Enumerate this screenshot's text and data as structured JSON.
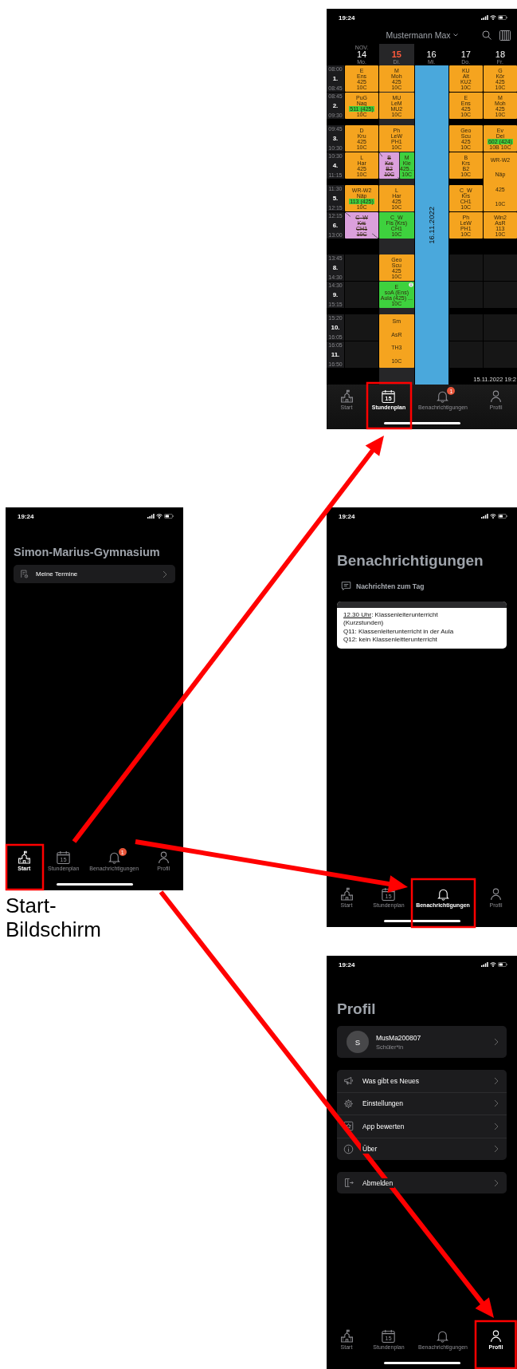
{
  "screens": [
    {
      "kind": "timetable",
      "status_time": "19:24",
      "person": "Mustermann Max",
      "timestamp": "15.11.2022 19:2",
      "periods": [
        {
          "kind": "period",
          "number": "1.",
          "start": "08:00",
          "end": "08:45"
        },
        {
          "kind": "period",
          "number": "2.",
          "start": "08:45",
          "end": "09:30"
        },
        {
          "kind": "break"
        },
        {
          "kind": "period",
          "number": "3.",
          "start": "09:45",
          "end": "10:30"
        },
        {
          "kind": "period",
          "number": "4.",
          "start": "10:30",
          "end": "11:15"
        },
        {
          "kind": "break"
        },
        {
          "kind": "period",
          "number": "5.",
          "start": "11:30",
          "end": "12:15"
        },
        {
          "kind": "period",
          "number": "6.",
          "start": "12:15",
          "end": "13:00"
        },
        {
          "kind": "free"
        },
        {
          "kind": "period",
          "number": "8.",
          "start": "13:45",
          "end": "14:30"
        },
        {
          "kind": "period",
          "number": "9.",
          "start": "14:30",
          "end": "15:15"
        },
        {
          "kind": "break"
        },
        {
          "kind": "period",
          "number": "10.",
          "start": "15:20",
          "end": "16:05"
        },
        {
          "kind": "period",
          "number": "11.",
          "start": "16:05",
          "end": "16:50"
        }
      ],
      "days": [
        {
          "month": "NOV.",
          "date": "14",
          "weekday": "Mo.",
          "today": false,
          "cells": [
            {
              "kind": "lesson",
              "changed": false,
              "cancelled": false,
              "lines": [
                "E",
                "Ens",
                "425",
                "10C"
              ]
            },
            {
              "kind": "lesson",
              "changed": false,
              "cancelled": false,
              "room_changed": true,
              "lines": [
                "PuG",
                "Nag",
                "511 (425)",
                "10C"
              ]
            },
            {
              "kind": "empty"
            },
            {
              "kind": "lesson",
              "changed": false,
              "cancelled": false,
              "lines": [
                "D",
                "Kru",
                "425",
                "10C"
              ]
            },
            {
              "kind": "lesson",
              "changed": false,
              "cancelled": false,
              "lines": [
                "L",
                "Har",
                "425",
                "10C"
              ]
            },
            {
              "kind": "empty"
            },
            {
              "kind": "lesson",
              "changed": false,
              "cancelled": false,
              "room_changed": true,
              "lines": [
                "WR-W2",
                "Näp",
                "113 (425)",
                "10C"
              ]
            },
            {
              "kind": "lesson",
              "changed": false,
              "cancelled": true,
              "lines": [
                "C_W",
                "Krs",
                "CH1",
                "10C"
              ]
            },
            {
              "kind": "empty"
            },
            {
              "kind": "empty"
            },
            {
              "kind": "empty"
            },
            {
              "kind": "empty"
            },
            {
              "kind": "empty"
            },
            {
              "kind": "empty"
            }
          ]
        },
        {
          "date": "15",
          "weekday": "Di.",
          "today": true,
          "cells": [
            {
              "kind": "lesson",
              "changed": false,
              "cancelled": false,
              "lines": [
                "M",
                "Moh",
                "425",
                "10C"
              ]
            },
            {
              "kind": "lesson",
              "changed": false,
              "cancelled": false,
              "lines": [
                "MU",
                "LeM",
                "MU2",
                "10C"
              ]
            },
            {
              "kind": "empty"
            },
            {
              "kind": "lesson",
              "changed": false,
              "cancelled": false,
              "lines": [
                "Ph",
                "LeW",
                "PH1",
                "10C"
              ]
            },
            {
              "kind": "split",
              "parts": [
                {
                  "changed": false,
                  "cancelled": true,
                  "lines": [
                    "B",
                    "Krs",
                    "B2",
                    "10C"
                  ]
                },
                {
                  "changed": true,
                  "cancelled": false,
                  "lines": [
                    "M",
                    "Kie",
                    "425...",
                    "10C"
                  ]
                }
              ]
            },
            {
              "kind": "empty"
            },
            {
              "kind": "lesson",
              "changed": false,
              "cancelled": false,
              "lines": [
                "L",
                "Har",
                "425",
                "10C"
              ]
            },
            {
              "kind": "lesson",
              "changed": true,
              "cancelled": false,
              "lines": [
                "C_W",
                "Fis (Krs)",
                "CH1",
                "10C"
              ]
            },
            {
              "kind": "empty"
            },
            {
              "kind": "lesson",
              "changed": false,
              "cancelled": false,
              "lines": [
                "Geo",
                "Scu",
                "425",
                "10C"
              ]
            },
            {
              "kind": "lesson",
              "changed": true,
              "cancelled": false,
              "info": true,
              "lines": [
                "E",
                "soA (Ens)",
                "Aula (425) ...",
                "10C"
              ]
            },
            {
              "kind": "empty"
            },
            {
              "kind": "lesson",
              "changed": false,
              "cancelled": false,
              "lines": [
                "Sm",
                "AsR",
                "TH3",
                "10C"
              ]
            },
            {
              "kind": "covered"
            }
          ]
        },
        {
          "date": "16",
          "weekday": "Mi.",
          "today": false,
          "holiday": "16.11.2022"
        },
        {
          "date": "17",
          "weekday": "Do.",
          "today": false,
          "cells": [
            {
              "kind": "lesson",
              "changed": false,
              "cancelled": false,
              "lines": [
                "KU",
                "Alt",
                "KU2",
                "10C"
              ]
            },
            {
              "kind": "lesson",
              "changed": false,
              "cancelled": false,
              "lines": [
                "E",
                "Ens",
                "425",
                "10C"
              ]
            },
            {
              "kind": "empty"
            },
            {
              "kind": "lesson",
              "changed": false,
              "cancelled": false,
              "lines": [
                "Geo",
                "Scu",
                "425",
                "10C"
              ]
            },
            {
              "kind": "lesson",
              "changed": false,
              "cancelled": false,
              "lines": [
                "B",
                "Krs",
                "B2",
                "10C"
              ]
            },
            {
              "kind": "empty"
            },
            {
              "kind": "lesson",
              "changed": false,
              "cancelled": false,
              "lines": [
                "C_W",
                "Krs",
                "CH1",
                "10C"
              ]
            },
            {
              "kind": "lesson",
              "changed": false,
              "cancelled": false,
              "lines": [
                "Ph",
                "LeW",
                "PH1",
                "10C"
              ]
            },
            {
              "kind": "empty"
            },
            {
              "kind": "empty"
            },
            {
              "kind": "empty"
            },
            {
              "kind": "empty"
            },
            {
              "kind": "empty"
            },
            {
              "kind": "empty"
            }
          ]
        },
        {
          "date": "18",
          "weekday": "Fr.",
          "today": false,
          "cells": [
            {
              "kind": "lesson",
              "changed": false,
              "cancelled": false,
              "lines": [
                "G",
                "Kör",
                "425",
                "10C"
              ]
            },
            {
              "kind": "lesson",
              "changed": false,
              "cancelled": false,
              "lines": [
                "M",
                "Moh",
                "425",
                "10C"
              ]
            },
            {
              "kind": "empty"
            },
            {
              "kind": "lesson",
              "changed": false,
              "cancelled": false,
              "room_changed": true,
              "lines": [
                "Ev",
                "Dei",
                "602 (424)",
                "10B 10C"
              ]
            },
            {
              "kind": "lesson",
              "changed": false,
              "cancelled": false,
              "lines": [
                "WR-W2",
                "Näp",
                "425",
                "10C"
              ]
            },
            {
              "kind": "covered"
            },
            {
              "kind": "covered"
            },
            {
              "kind": "lesson",
              "changed": false,
              "cancelled": false,
              "lines": [
                "Win2",
                "AsR",
                "113",
                "10C"
              ]
            },
            {
              "kind": "empty"
            },
            {
              "kind": "empty"
            },
            {
              "kind": "empty"
            },
            {
              "kind": "empty"
            },
            {
              "kind": "empty"
            },
            {
              "kind": "empty"
            }
          ]
        }
      ],
      "tabs": [
        {
          "kind": "start",
          "label": "Start",
          "selected": false
        },
        {
          "kind": "timetable",
          "label": "Stundenplan",
          "icon_text": "15",
          "selected": true
        },
        {
          "kind": "notifications",
          "label": "Benachrichtigungen",
          "badge": "1",
          "selected": false
        },
        {
          "kind": "profile",
          "label": "Profil",
          "selected": false
        }
      ]
    },
    {
      "kind": "start",
      "status_time": "19:24",
      "title": "Simon-Marius-Gymnasium",
      "items": [
        {
          "label": "Meine Termine"
        }
      ],
      "tabs": [
        {
          "kind": "start",
          "label": "Start",
          "selected": true
        },
        {
          "kind": "timetable",
          "label": "Stundenplan",
          "icon_text": "15",
          "selected": false
        },
        {
          "kind": "notifications",
          "label": "Benachrichtigungen",
          "badge": "1",
          "selected": false
        },
        {
          "kind": "profile",
          "label": "Profil",
          "selected": false
        }
      ]
    },
    {
      "kind": "notifications",
      "status_time": "19:24",
      "title": "Benachrichtigungen",
      "section": "Nachrichten zum Tag",
      "message": {
        "link": "12.30 Uhr",
        "text": ": Klassenleiterunterricht\n(Kurzstunden)\nQ11: Klassenleiterunterricht in der Aula\nQ12: kein Klassenleitterunterricht"
      },
      "tabs": [
        {
          "kind": "start",
          "label": "Start",
          "selected": false
        },
        {
          "kind": "timetable",
          "label": "Stundenplan",
          "icon_text": "15",
          "selected": false
        },
        {
          "kind": "notifications",
          "label": "Benachrichtigungen",
          "selected": true
        },
        {
          "kind": "profile",
          "label": "Profil",
          "selected": false
        }
      ]
    },
    {
      "kind": "profile",
      "status_time": "19:24",
      "title": "Profil",
      "user": {
        "initial": "S",
        "name": "MusMa200807",
        "role": "Schüler*in"
      },
      "menu": [
        {
          "kind": "news",
          "label": "Was gibt es Neues"
        },
        {
          "kind": "settings",
          "label": "Einstellungen"
        },
        {
          "kind": "rate",
          "label": "App bewerten"
        },
        {
          "kind": "about",
          "label": "Über"
        }
      ],
      "logout": {
        "label": "Abmelden"
      },
      "tabs": [
        {
          "kind": "start",
          "label": "Start",
          "selected": false
        },
        {
          "kind": "timetable",
          "label": "Stundenplan",
          "icon_text": "15",
          "selected": false
        },
        {
          "kind": "notifications",
          "label": "Benachrichtigungen",
          "selected": false
        },
        {
          "kind": "profile",
          "label": "Profil",
          "selected": true
        }
      ]
    }
  ],
  "caption": "Start-Bildschirm"
}
